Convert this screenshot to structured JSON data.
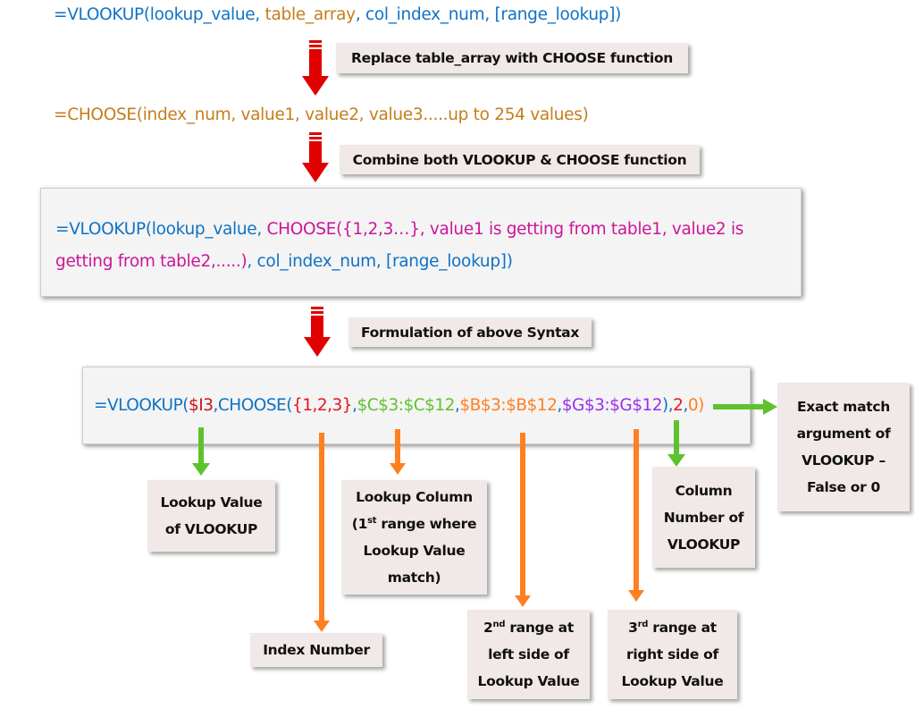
{
  "colors": {
    "blue": "#0f72c4",
    "brown": "#c47d1c",
    "magenta": "#cc1599",
    "red": "#e8141c",
    "green": "#5ec22d",
    "orange": "#ff8020",
    "purple": "#9a2ff0",
    "arrow_red": "#e00000"
  },
  "line1": {
    "p1": "=VLOOKUP(lookup_value, ",
    "p2": "table_array",
    "p3": ", col_index_num, [range_lookup])"
  },
  "step1": "Replace table_array with CHOOSE function",
  "line2": "=CHOOSE(index_num, value1, value2, value3.....up to 254 values)",
  "step2": "Combine both VLOOKUP & CHOOSE function",
  "combined": {
    "a1": "=VLOOKUP(lookup_value, ",
    "a2": "CHOOSE({1,2,3…}, value1 is getting from table1, value2 is",
    "b1": "getting from table2,.....)",
    "b2": ", col_index_num, [range_lookup])"
  },
  "step3": "Formulation of above Syntax",
  "formula": {
    "t1": "=VLOOKUP(",
    "t2": "$I3",
    "t3": ",CHOOSE(",
    "t4": "{1,2,3}",
    "t5": ",",
    "t6": "$C$3:$C$12",
    "t7": ",",
    "t8": "$B$3:$B$12",
    "t9": ",",
    "t10": "$G$3:$G$12",
    "t11": "),",
    "t12": "2",
    "t13": ",",
    "t14": "0",
    "t15": ")"
  },
  "labels": {
    "lookup_value": [
      "Lookup Value",
      "of VLOOKUP"
    ],
    "lookup_column": {
      "l1": "Lookup Column",
      "l2a": "(1",
      "l2sup": "st",
      "l2b": " range where",
      "l3": "Lookup Value",
      "l4": "match)"
    },
    "index_number": "Index Number",
    "second_range": {
      "l1a": "2",
      "l1sup": "nd",
      "l1b": " range at",
      "l2": "left side of",
      "l3": "Lookup Value"
    },
    "third_range": {
      "l1a": "3",
      "l1sup": "rd",
      "l1b": " range at",
      "l2": "right side of",
      "l3": "Lookup Value"
    },
    "column_number": [
      "Column",
      "Number of",
      "VLOOKUP"
    ],
    "exact_match": [
      "Exact match",
      "argument of",
      "VLOOKUP –",
      "False or 0"
    ]
  }
}
